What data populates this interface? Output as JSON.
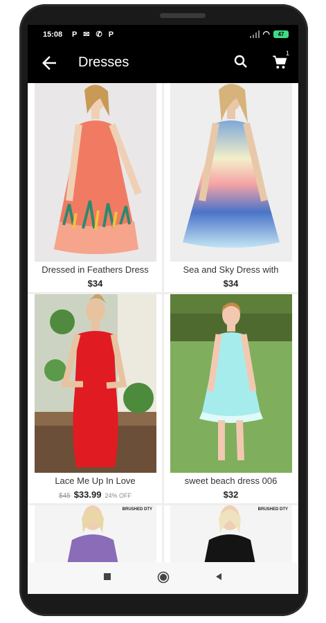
{
  "status_bar": {
    "time": "15:08",
    "notifications": "P ✉ ✆ P",
    "battery": "47"
  },
  "app_bar": {
    "title": "Dresses",
    "cart_count": "1"
  },
  "products": [
    {
      "name": "Dressed in Feathers Dress",
      "price": "$34"
    },
    {
      "name": "Sea and Sky Dress with",
      "price": "$34"
    },
    {
      "name": "Lace Me Up In Love",
      "old_price": "$45",
      "price": "$33.99",
      "discount": "24% OFF"
    },
    {
      "name": "sweet beach dress 006",
      "price": "$32"
    },
    {
      "tag": "BRUSHED DTY"
    },
    {
      "tag": "BRUSHED DTY"
    }
  ],
  "colors": {
    "bar_bg": "#000000",
    "screen_bg": "#ffffff",
    "grid_bg": "#eeeeee",
    "battery": "#3ddc84"
  },
  "icons": [
    "back-arrow-icon",
    "search-icon",
    "cart-icon",
    "nav-square-icon",
    "nav-circle-icon",
    "nav-triangle-icon"
  ]
}
